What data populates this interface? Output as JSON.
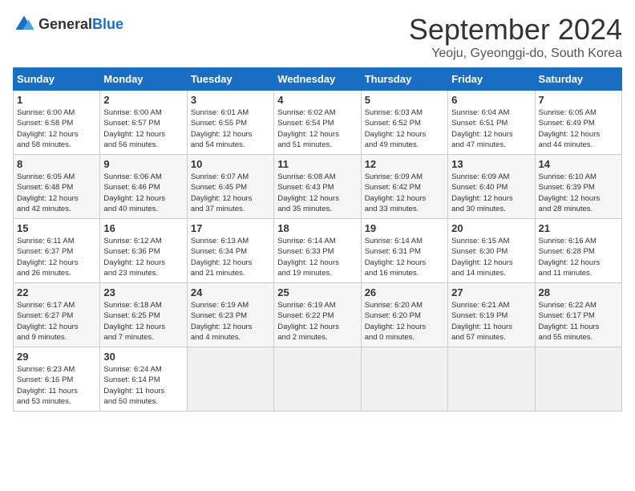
{
  "logo": {
    "text_general": "General",
    "text_blue": "Blue"
  },
  "title": "September 2024",
  "subtitle": "Yeoju, Gyeonggi-do, South Korea",
  "headers": [
    "Sunday",
    "Monday",
    "Tuesday",
    "Wednesday",
    "Thursday",
    "Friday",
    "Saturday"
  ],
  "weeks": [
    [
      {
        "day": "1",
        "info": "Sunrise: 6:00 AM\nSunset: 6:58 PM\nDaylight: 12 hours\nand 58 minutes."
      },
      {
        "day": "2",
        "info": "Sunrise: 6:00 AM\nSunset: 6:57 PM\nDaylight: 12 hours\nand 56 minutes."
      },
      {
        "day": "3",
        "info": "Sunrise: 6:01 AM\nSunset: 6:55 PM\nDaylight: 12 hours\nand 54 minutes."
      },
      {
        "day": "4",
        "info": "Sunrise: 6:02 AM\nSunset: 6:54 PM\nDaylight: 12 hours\nand 51 minutes."
      },
      {
        "day": "5",
        "info": "Sunrise: 6:03 AM\nSunset: 6:52 PM\nDaylight: 12 hours\nand 49 minutes."
      },
      {
        "day": "6",
        "info": "Sunrise: 6:04 AM\nSunset: 6:51 PM\nDaylight: 12 hours\nand 47 minutes."
      },
      {
        "day": "7",
        "info": "Sunrise: 6:05 AM\nSunset: 6:49 PM\nDaylight: 12 hours\nand 44 minutes."
      }
    ],
    [
      {
        "day": "8",
        "info": "Sunrise: 6:05 AM\nSunset: 6:48 PM\nDaylight: 12 hours\nand 42 minutes."
      },
      {
        "day": "9",
        "info": "Sunrise: 6:06 AM\nSunset: 6:46 PM\nDaylight: 12 hours\nand 40 minutes."
      },
      {
        "day": "10",
        "info": "Sunrise: 6:07 AM\nSunset: 6:45 PM\nDaylight: 12 hours\nand 37 minutes."
      },
      {
        "day": "11",
        "info": "Sunrise: 6:08 AM\nSunset: 6:43 PM\nDaylight: 12 hours\nand 35 minutes."
      },
      {
        "day": "12",
        "info": "Sunrise: 6:09 AM\nSunset: 6:42 PM\nDaylight: 12 hours\nand 33 minutes."
      },
      {
        "day": "13",
        "info": "Sunrise: 6:09 AM\nSunset: 6:40 PM\nDaylight: 12 hours\nand 30 minutes."
      },
      {
        "day": "14",
        "info": "Sunrise: 6:10 AM\nSunset: 6:39 PM\nDaylight: 12 hours\nand 28 minutes."
      }
    ],
    [
      {
        "day": "15",
        "info": "Sunrise: 6:11 AM\nSunset: 6:37 PM\nDaylight: 12 hours\nand 26 minutes."
      },
      {
        "day": "16",
        "info": "Sunrise: 6:12 AM\nSunset: 6:36 PM\nDaylight: 12 hours\nand 23 minutes."
      },
      {
        "day": "17",
        "info": "Sunrise: 6:13 AM\nSunset: 6:34 PM\nDaylight: 12 hours\nand 21 minutes."
      },
      {
        "day": "18",
        "info": "Sunrise: 6:14 AM\nSunset: 6:33 PM\nDaylight: 12 hours\nand 19 minutes."
      },
      {
        "day": "19",
        "info": "Sunrise: 6:14 AM\nSunset: 6:31 PM\nDaylight: 12 hours\nand 16 minutes."
      },
      {
        "day": "20",
        "info": "Sunrise: 6:15 AM\nSunset: 6:30 PM\nDaylight: 12 hours\nand 14 minutes."
      },
      {
        "day": "21",
        "info": "Sunrise: 6:16 AM\nSunset: 6:28 PM\nDaylight: 12 hours\nand 11 minutes."
      }
    ],
    [
      {
        "day": "22",
        "info": "Sunrise: 6:17 AM\nSunset: 6:27 PM\nDaylight: 12 hours\nand 9 minutes."
      },
      {
        "day": "23",
        "info": "Sunrise: 6:18 AM\nSunset: 6:25 PM\nDaylight: 12 hours\nand 7 minutes."
      },
      {
        "day": "24",
        "info": "Sunrise: 6:19 AM\nSunset: 6:23 PM\nDaylight: 12 hours\nand 4 minutes."
      },
      {
        "day": "25",
        "info": "Sunrise: 6:19 AM\nSunset: 6:22 PM\nDaylight: 12 hours\nand 2 minutes."
      },
      {
        "day": "26",
        "info": "Sunrise: 6:20 AM\nSunset: 6:20 PM\nDaylight: 12 hours\nand 0 minutes."
      },
      {
        "day": "27",
        "info": "Sunrise: 6:21 AM\nSunset: 6:19 PM\nDaylight: 11 hours\nand 57 minutes."
      },
      {
        "day": "28",
        "info": "Sunrise: 6:22 AM\nSunset: 6:17 PM\nDaylight: 11 hours\nand 55 minutes."
      }
    ],
    [
      {
        "day": "29",
        "info": "Sunrise: 6:23 AM\nSunset: 6:16 PM\nDaylight: 11 hours\nand 53 minutes."
      },
      {
        "day": "30",
        "info": "Sunrise: 6:24 AM\nSunset: 6:14 PM\nDaylight: 11 hours\nand 50 minutes."
      },
      {
        "day": "",
        "info": ""
      },
      {
        "day": "",
        "info": ""
      },
      {
        "day": "",
        "info": ""
      },
      {
        "day": "",
        "info": ""
      },
      {
        "day": "",
        "info": ""
      }
    ]
  ]
}
